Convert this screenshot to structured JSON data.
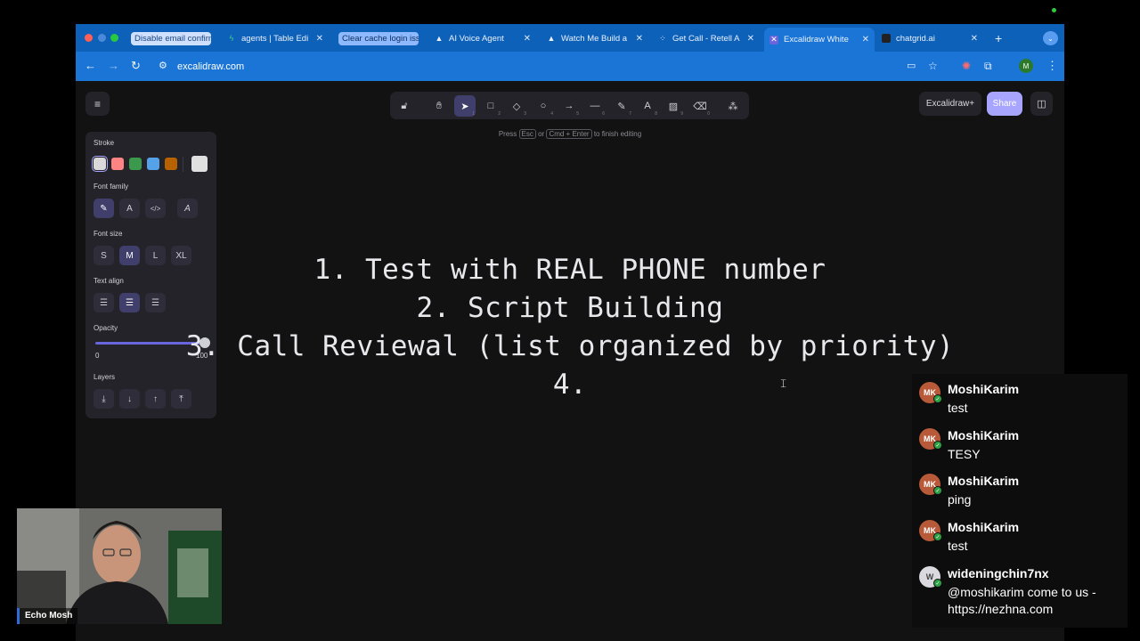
{
  "browser": {
    "tabs": [
      {
        "title": "Disable email confirm",
        "icon": "tab-group-label"
      },
      {
        "title": "agents | Table Edi",
        "icon": "supabase-icon"
      },
      {
        "title": "Clear cache login iss",
        "icon": "tab-group-label"
      },
      {
        "title": "AI Voice Agent",
        "icon": "triangle-icon"
      },
      {
        "title": "Watch Me Build a",
        "icon": "triangle-icon"
      },
      {
        "title": "Get Call - Retell A",
        "icon": "dots-icon"
      },
      {
        "title": "Excalidraw White",
        "icon": "excalidraw-icon"
      },
      {
        "title": "chatgrid.ai",
        "icon": "chatgrid-icon"
      }
    ],
    "new_tab": "+",
    "url": "excalidraw.com",
    "profile_initial": "M"
  },
  "excalidraw": {
    "toolbar_buttons": {
      "plus": "Excalidraw+",
      "share": "Share"
    },
    "tool_numbers": [
      "1",
      "2",
      "3",
      "4",
      "5",
      "6",
      "7",
      "8",
      "9",
      "0"
    ],
    "hint": {
      "pre": "Press",
      "key1": "Esc",
      "mid": "or",
      "key2": "Cmd + Enter",
      "post": "to finish editing"
    },
    "panel": {
      "stroke_label": "Stroke",
      "stroke_colors": [
        "#d9d9d9",
        "#ff8383",
        "#3a994c",
        "#56a2e8",
        "#b76100"
      ],
      "current_stroke": "#e0e0e0",
      "font_family_label": "Font family",
      "font_size_label": "Font size",
      "font_sizes": [
        "S",
        "M",
        "L",
        "XL"
      ],
      "text_align_label": "Text align",
      "opacity_label": "Opacity",
      "opacity_min": "0",
      "opacity_max": "100",
      "opacity_value": 100,
      "layers_label": "Layers"
    },
    "canvas_text": [
      "1. Test with REAL PHONE number",
      "2. Script Building",
      "3. Call Reviewal (list organized by priority)",
      "4."
    ]
  },
  "chat": {
    "messages": [
      {
        "user": "MoshiKarim",
        "text": "test"
      },
      {
        "user": "MoshiKarim",
        "text": "TESY"
      },
      {
        "user": "MoshiKarim",
        "text": "ping"
      },
      {
        "user": "MoshiKarim",
        "text": "test"
      },
      {
        "user": "wideningchin7nx",
        "text": "@moshikarim come to us - https://nezhna.com"
      }
    ]
  },
  "webcam": {
    "name": "Echo Mosh"
  }
}
